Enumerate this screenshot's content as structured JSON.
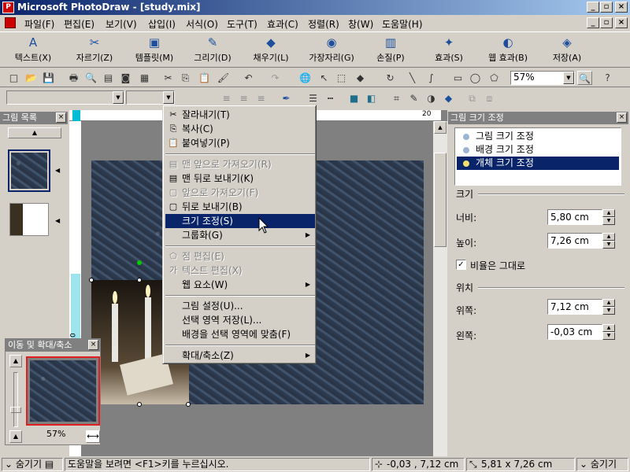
{
  "window": {
    "title": "Microsoft PhotoDraw - [study.mix]",
    "app_icon_glyph": "P"
  },
  "menu": {
    "items": [
      "파일(F)",
      "편집(E)",
      "보기(V)",
      "삽입(I)",
      "서식(O)",
      "도구(T)",
      "효과(C)",
      "정렬(R)",
      "창(W)",
      "도움말(H)"
    ]
  },
  "bigtoolbar": {
    "items": [
      {
        "label": "텍스트(X)",
        "icon": "A"
      },
      {
        "label": "자르기(Z)",
        "icon": "✂"
      },
      {
        "label": "템플릿(M)",
        "icon": "▣"
      },
      {
        "label": "그리기(D)",
        "icon": "✎"
      },
      {
        "label": "채우기(L)",
        "icon": "◆"
      },
      {
        "label": "가장자리(G)",
        "icon": "◉"
      },
      {
        "label": "손질(P)",
        "icon": "▥"
      },
      {
        "label": "효과(S)",
        "icon": "✦"
      },
      {
        "label": "웹 효과(B)",
        "icon": "◐"
      },
      {
        "label": "저장(A)",
        "icon": "◈"
      }
    ]
  },
  "stdtoolbar": {
    "zoom": "57%"
  },
  "left_panel": {
    "title": "그림 목록"
  },
  "nav_panel": {
    "title": "이동 및 확대/축소",
    "zoom": "57%"
  },
  "ruler": {
    "top_label": "20",
    "side_label": "10"
  },
  "context_menu": {
    "items": [
      {
        "label": "잘라내기(T)",
        "icon": "✂",
        "disabled": false
      },
      {
        "label": "복사(C)",
        "icon": "⎘",
        "disabled": false
      },
      {
        "label": "붙여넣기(P)",
        "icon": "📋",
        "disabled": false
      },
      {
        "sep": true
      },
      {
        "label": "맨 앞으로 가져오기(R)",
        "icon": "▤",
        "disabled": true
      },
      {
        "label": "맨 뒤로 보내기(K)",
        "icon": "▤",
        "disabled": false
      },
      {
        "label": "앞으로 가져오기(F)",
        "icon": "▢",
        "disabled": true
      },
      {
        "label": "뒤로 보내기(B)",
        "icon": "▢",
        "disabled": false
      },
      {
        "label": "크기 조정(S)",
        "icon": "",
        "disabled": false,
        "selected": true
      },
      {
        "label": "그룹화(G)",
        "icon": "",
        "disabled": false,
        "submenu": true
      },
      {
        "sep": true
      },
      {
        "label": "점 편집(E)",
        "icon": "⬠",
        "disabled": true
      },
      {
        "label": "텍스트 편집(X)",
        "icon": "가",
        "disabled": true
      },
      {
        "label": "웹 요소(W)",
        "icon": "",
        "disabled": false,
        "submenu": true
      },
      {
        "sep": true
      },
      {
        "label": "그림 설정(U)...",
        "icon": "",
        "disabled": false
      },
      {
        "label": "선택 영역 저장(L)...",
        "icon": "",
        "disabled": false
      },
      {
        "label": "배경을 선택 영역에 맞춤(F)",
        "icon": "",
        "disabled": false
      },
      {
        "sep": true
      },
      {
        "label": "확대/축소(Z)",
        "icon": "",
        "disabled": false,
        "submenu": true
      }
    ]
  },
  "right_panel": {
    "title": "그림 크기 조정",
    "options": [
      "그림 크기 조정",
      "배경 크기 조정",
      "개체 크기 조정"
    ],
    "selected_option": 2,
    "size_section": "크기",
    "width_label": "너비:",
    "width_value": "5,80 cm",
    "height_label": "높이:",
    "height_value": "7,26 cm",
    "keep_ratio_label": "비율은 그대로",
    "keep_ratio_checked": true,
    "position_section": "위치",
    "top_label": "위쪽:",
    "top_value": "7,12 cm",
    "left_label": "왼쪽:",
    "left_value": "-0,03 cm"
  },
  "status": {
    "left_toggle": "숨기기",
    "hint": "도움말을 보려면 <F1>키를 누르십시오.",
    "position": "-0,03 , 7,12  cm",
    "size": "5,81 x 7,26  cm",
    "right_toggle": "숨기기"
  }
}
